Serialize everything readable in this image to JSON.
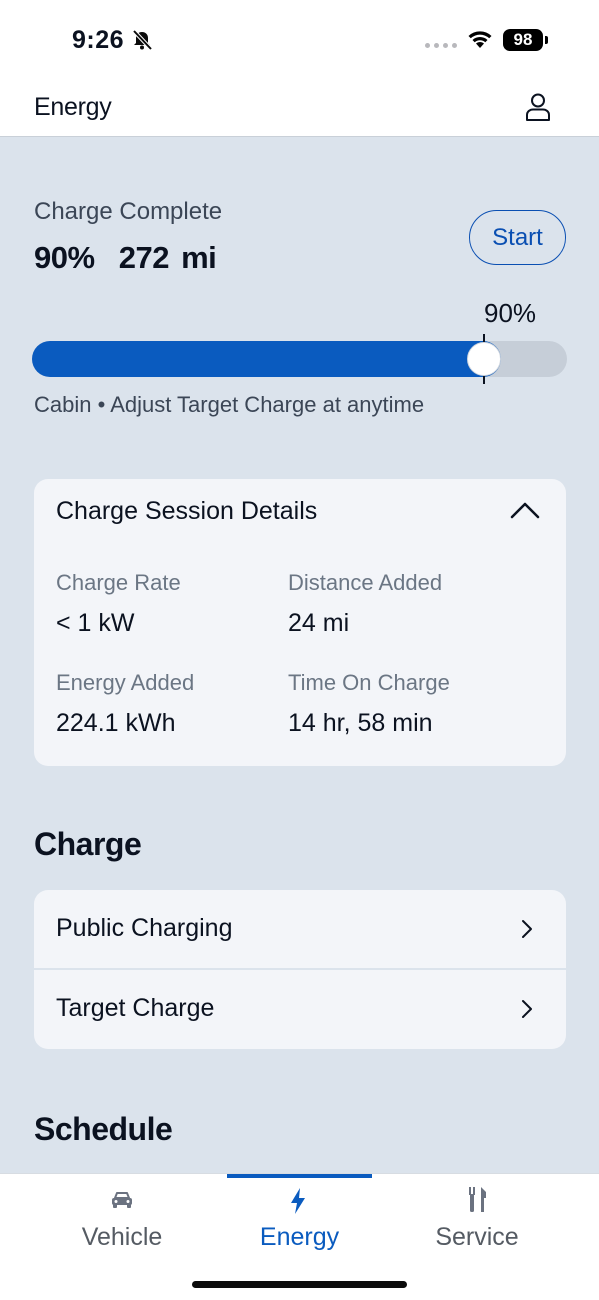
{
  "status_bar": {
    "time": "9:26",
    "battery": "98",
    "icons": [
      "bell-slash-icon",
      "signal-dots-icon",
      "wifi-icon",
      "battery-icon"
    ]
  },
  "header": {
    "title": "Energy",
    "profile_icon": "person-icon"
  },
  "charge": {
    "status": "Charge Complete",
    "summary": "90%  272 mi",
    "start_label": "Start",
    "target_label": "90%",
    "level_fraction": 0.9,
    "note": "Cabin • Adjust Target Charge at anytime"
  },
  "session": {
    "title": "Charge Session Details",
    "details": [
      {
        "label": "Charge Rate",
        "value": "< 1 kW"
      },
      {
        "label": "Distance Added",
        "value": "24 mi"
      },
      {
        "label": "Energy Added",
        "value": "224.1 kWh"
      },
      {
        "label": "Time On Charge",
        "value": "14 hr, 58 min"
      }
    ]
  },
  "charge_section": {
    "title": "Charge",
    "items": [
      {
        "label": "Public Charging"
      },
      {
        "label": "Target Charge"
      }
    ]
  },
  "schedule_section": {
    "title": "Schedule"
  },
  "nav": {
    "items": [
      {
        "label": "Vehicle",
        "icon": "car-icon"
      },
      {
        "label": "Energy",
        "icon": "bolt-icon",
        "active": true
      },
      {
        "label": "Service",
        "icon": "tools-icon"
      }
    ]
  },
  "colors": {
    "accent": "#0a5bbf",
    "background": "#dbe3ec",
    "card": "#f3f5f9"
  }
}
